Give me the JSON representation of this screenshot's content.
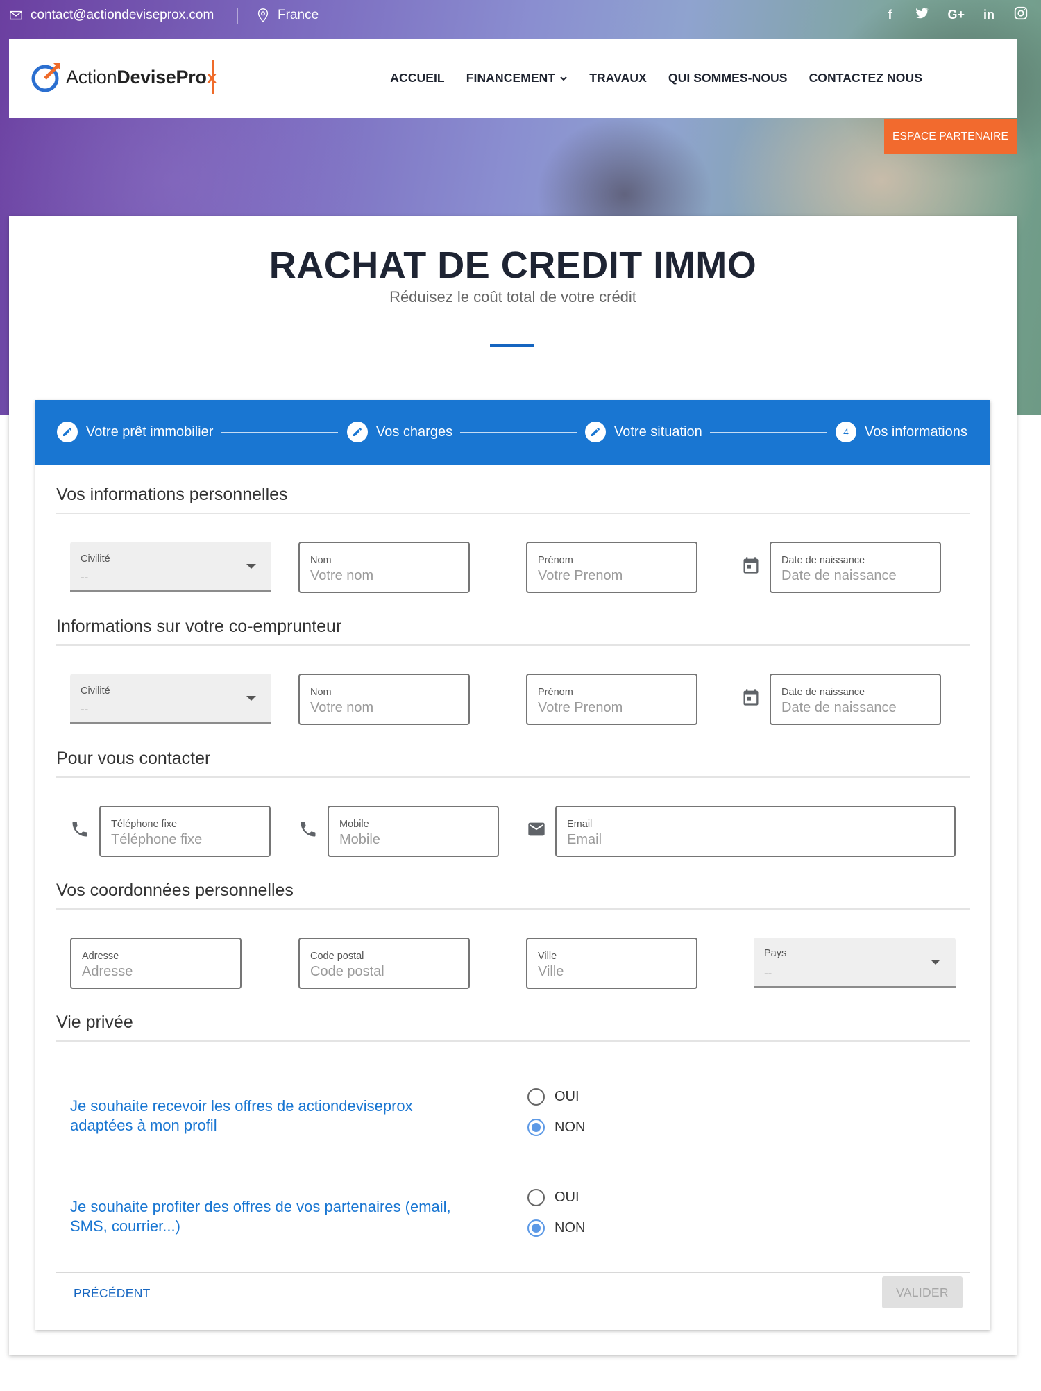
{
  "topbar": {
    "email": "contact@actiondeviseprox.com",
    "location": "France",
    "socials": [
      "f",
      "t",
      "G+",
      "in",
      "ig"
    ]
  },
  "header": {
    "logo_text_light": "Action",
    "logo_text_bold": "DevisePro",
    "logo_text_accent": "x",
    "nav": [
      "ACCUEIL",
      "FINANCEMENT",
      "TRAVAUX",
      "QUI SOMMES-NOUS",
      "CONTACTEZ NOUS"
    ],
    "partner_button": "ESPACE PARTENAIRE"
  },
  "page": {
    "title": "RACHAT DE CREDIT IMMO",
    "subtitle": "Réduisez le coût total de votre crédit"
  },
  "stepper": {
    "steps": [
      {
        "label": "Votre prêt immobilier",
        "state": "edit"
      },
      {
        "label": "Vos charges",
        "state": "edit"
      },
      {
        "label": "Votre situation",
        "state": "edit"
      },
      {
        "label": "Vos informations",
        "state": "active",
        "number": "4"
      }
    ]
  },
  "sections": {
    "personal": "Vos informations personnelles",
    "coborrower": "Informations sur votre co-emprunteur",
    "contact": "Pour vous contacter",
    "address": "Vos coordonnées personnelles",
    "privacy": "Vie privée"
  },
  "fields": {
    "civilite": {
      "label": "Civilité",
      "value": "--"
    },
    "nom": {
      "label": "Nom",
      "placeholder": "Votre nom"
    },
    "prenom": {
      "label": "Prénom",
      "placeholder": "Votre Prenom"
    },
    "naissance": {
      "label": "Date de naissance",
      "placeholder": "Date de naissance"
    },
    "tel_fixe": {
      "label": "Téléphone fixe",
      "placeholder": "Téléphone fixe"
    },
    "mobile": {
      "label": "Mobile",
      "placeholder": "Mobile"
    },
    "email": {
      "label": "Email",
      "placeholder": "Email"
    },
    "adresse": {
      "label": "Adresse",
      "placeholder": "Adresse"
    },
    "code_postal": {
      "label": "Code postal",
      "placeholder": "Code postal"
    },
    "ville": {
      "label": "Ville",
      "placeholder": "Ville"
    },
    "pays": {
      "label": "Pays",
      "value": "--"
    }
  },
  "privacy": {
    "q1_line1": "Je souhaite recevoir les offres de actiondeviseprox",
    "q1_line2": "adaptées à mon profil",
    "q2_line1": "Je souhaite profiter des offres de vos partenaires (email,",
    "q2_line2": "SMS, courrier...)",
    "yes": "OUI",
    "no": "NON",
    "q1_selected": "NON",
    "q2_selected": "NON"
  },
  "actions": {
    "previous": "PRÉCÉDENT",
    "submit": "VALIDER"
  },
  "colors": {
    "primary": "#1976d2",
    "accent": "#f26a2e",
    "radio_selected": "#5c99e6"
  }
}
